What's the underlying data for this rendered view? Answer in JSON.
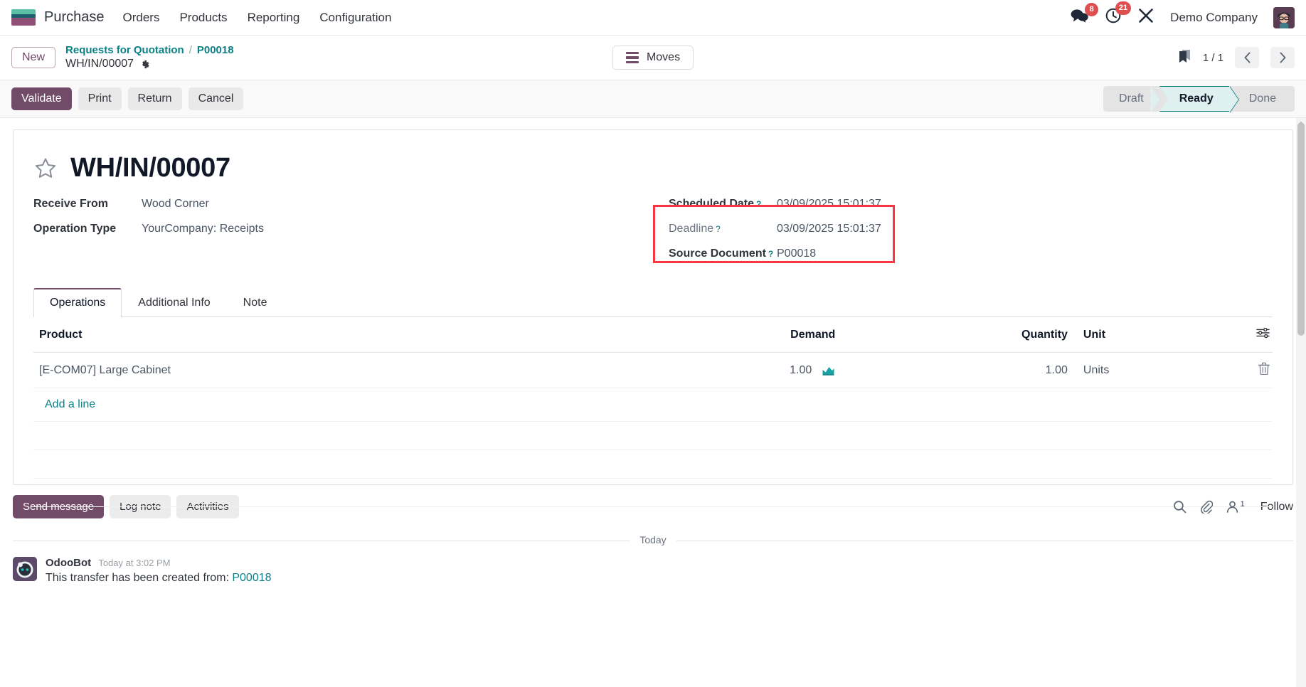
{
  "navbar": {
    "brand": "Purchase",
    "menu": [
      "Orders",
      "Products",
      "Reporting",
      "Configuration"
    ],
    "messages_badge": "8",
    "activities_badge": "21",
    "company": "Demo Company"
  },
  "breadcrumb": {
    "new_label": "New",
    "parent": "Requests for Quotation",
    "separator": "/",
    "record_ref": "P00018",
    "current": "WH/IN/00007",
    "moves_label": "Moves",
    "pager": "1 / 1"
  },
  "actions": {
    "validate": "Validate",
    "print": "Print",
    "return": "Return",
    "cancel": "Cancel"
  },
  "status": {
    "steps": [
      "Draft",
      "Ready",
      "Done"
    ],
    "active": "Ready"
  },
  "form": {
    "title": "WH/IN/00007",
    "receive_from_label": "Receive From",
    "receive_from_value": "Wood Corner",
    "operation_type_label": "Operation Type",
    "operation_type_value": "YourCompany: Receipts",
    "scheduled_date_label": "Scheduled Date",
    "scheduled_date_value": "03/09/2025 15:01:37",
    "deadline_label": "Deadline",
    "deadline_value": "03/09/2025 15:01:37",
    "source_document_label": "Source Document",
    "source_document_value": "P00018",
    "help_marker": "?",
    "highlight_color": "#fb3640"
  },
  "notebook": {
    "tabs": [
      "Operations",
      "Additional Info",
      "Note"
    ],
    "active_tab": "Operations",
    "columns": {
      "product": "Product",
      "demand": "Demand",
      "quantity": "Quantity",
      "unit": "Unit"
    },
    "rows": [
      {
        "product": "[E-COM07] Large Cabinet",
        "demand": "1.00",
        "quantity": "1.00",
        "unit": "Units"
      }
    ],
    "add_line": "Add a line"
  },
  "chatter": {
    "send_message": "Send message",
    "log_note": "Log note",
    "activities": "Activities",
    "follower_count": "1",
    "follow": "Follow",
    "divider": "Today",
    "messages": [
      {
        "author": "OdooBot",
        "time": "Today at 3:02 PM",
        "body_prefix": "This transfer has been created from:",
        "body_link": "P00018"
      }
    ]
  }
}
